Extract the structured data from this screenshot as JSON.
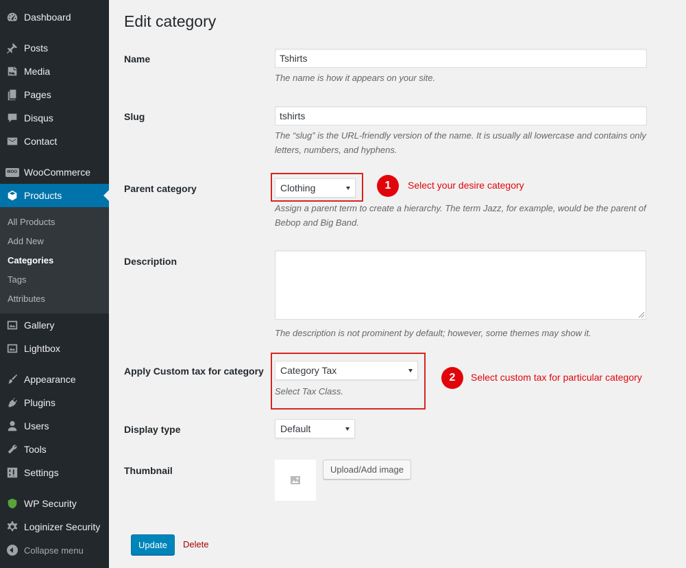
{
  "sidebar": {
    "items": [
      {
        "label": "Dashboard",
        "icon": "dashboard-icon"
      },
      {
        "label": "Posts",
        "icon": "pin-icon"
      },
      {
        "label": "Media",
        "icon": "media-icon"
      },
      {
        "label": "Pages",
        "icon": "pages-icon"
      },
      {
        "label": "Disqus",
        "icon": "comment-icon"
      },
      {
        "label": "Contact",
        "icon": "mail-icon"
      },
      {
        "label": "WooCommerce",
        "icon": "woocommerce-icon"
      },
      {
        "label": "Products",
        "icon": "box-icon"
      },
      {
        "label": "Gallery",
        "icon": "gallery-icon"
      },
      {
        "label": "Lightbox",
        "icon": "lightbox-icon"
      },
      {
        "label": "Appearance",
        "icon": "brush-icon"
      },
      {
        "label": "Plugins",
        "icon": "plugin-icon"
      },
      {
        "label": "Users",
        "icon": "user-icon"
      },
      {
        "label": "Tools",
        "icon": "wrench-icon"
      },
      {
        "label": "Settings",
        "icon": "settings-icon"
      },
      {
        "label": "WP Security",
        "icon": "shield-icon"
      },
      {
        "label": "Loginizer Security",
        "icon": "gear-icon"
      },
      {
        "label": "Collapse menu",
        "icon": "collapse-icon"
      }
    ],
    "submenu": [
      "All Products",
      "Add New",
      "Categories",
      "Tags",
      "Attributes"
    ],
    "woo_badge": "WOO"
  },
  "page": {
    "title": "Edit category",
    "name_label": "Name",
    "name_value": "Tshirts",
    "name_desc": "The name is how it appears on your site.",
    "slug_label": "Slug",
    "slug_value": "tshirts",
    "slug_desc": "The “slug” is the URL-friendly version of the name. It is usually all lowercase and contains only letters, numbers, and hyphens.",
    "parent_label": "Parent category",
    "parent_value": "Clothing",
    "parent_desc": "Assign a parent term to create a hierarchy. The term Jazz, for example, would be the parent of Bebop and Big Band.",
    "description_label": "Description",
    "description_desc": "The description is not prominent by default; however, some themes may show it.",
    "tax_label": "Apply Custom tax for category",
    "tax_value": "Category Tax",
    "tax_desc": "Select Tax Class.",
    "display_label": "Display type",
    "display_value": "Default",
    "thumb_label": "Thumbnail",
    "upload_button": "Upload/Add image",
    "update_button": "Update",
    "delete_link": "Delete"
  },
  "annotations": {
    "one_num": "1",
    "one_text": "Select your desire category",
    "two_num": "2",
    "two_text": "Select custom tax for particular category"
  },
  "colors": {
    "sidebar_bg": "#23282d",
    "active_bg": "#0073aa",
    "annotation_red": "#e1050b",
    "primary_button": "#0085ba"
  }
}
